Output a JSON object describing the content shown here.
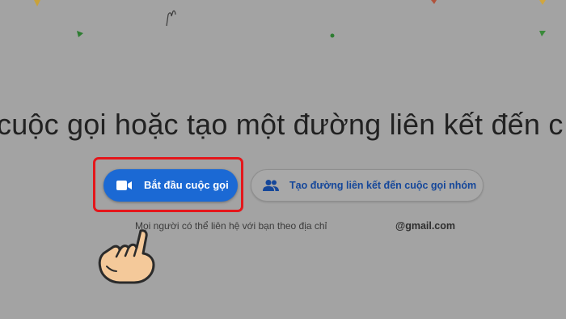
{
  "headline": "cuộc gọi hoặc tạo một đường liên kết đến c",
  "buttons": {
    "start_call": "Bắt đầu cuộc gọi",
    "group_link": "Tạo đường liên kết đến cuộc gọi nhóm"
  },
  "contact": {
    "text": "Mọi người có thể liên hệ với bạn theo địa chỉ",
    "email": "@gmail.com"
  },
  "icons": [
    "video-camera-icon",
    "people-icon",
    "pointing-hand-icon"
  ],
  "colors": {
    "background": "#a3a3a3",
    "primary_button": "#1b69d4",
    "highlight_border": "#e4161b",
    "group_button_text": "#15479a"
  }
}
